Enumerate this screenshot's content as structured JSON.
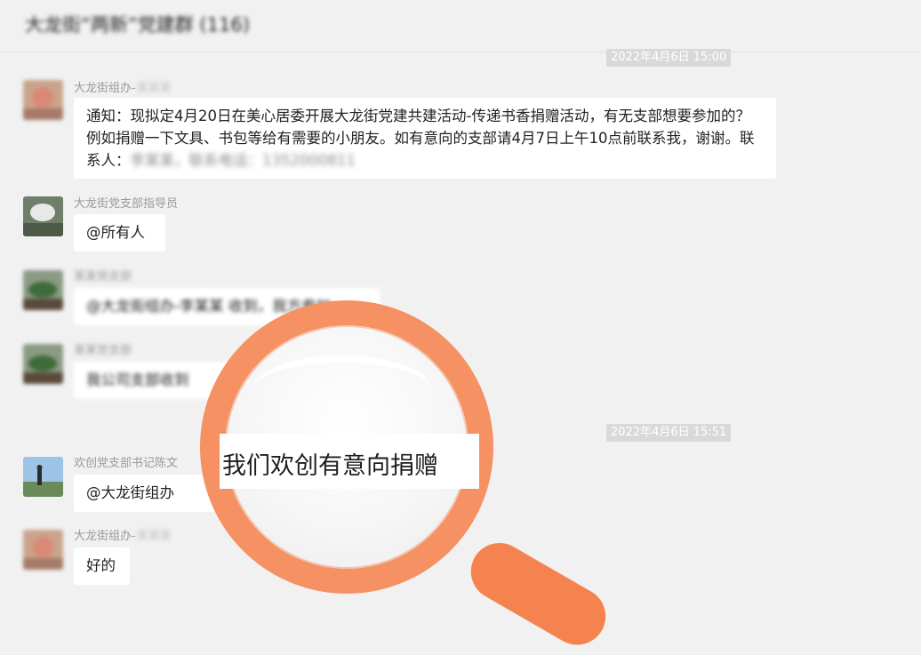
{
  "header": {
    "title": "大龙街“两新”党建群 (116)"
  },
  "timestamps": [
    "2022年4月6日 15:00",
    "2022年4月6日 15:51"
  ],
  "messages": [
    {
      "sender": "大龙街组办-",
      "sender_redacted": "某某某",
      "text": "通知：现拟定4月20日在美心居委开展大龙街党建共建活动-传递书香捐赠活动，有无支部想要参加的？例如捐赠一下文具、书包等给有需要的小朋友。如有意向的支部请4月7日上午10点前联系我，谢谢。联系人：",
      "text_redacted": "李某某，联系电话：1352000811"
    },
    {
      "sender": "大龙街党支部指导员",
      "text": "@所有人"
    },
    {
      "sender": "某某党支部",
      "text": "@大龙街组办-李某某 收到，我方参加",
      "blurred": true
    },
    {
      "sender": "某某党支部",
      "text": "我公司支部收到",
      "blurred": true
    },
    {
      "sender": "欢创党支部书记陈文",
      "text": "@大龙街组办"
    },
    {
      "sender": "大龙街组办-",
      "sender_redacted": "某某某",
      "text": "好的"
    }
  ],
  "magnifier": {
    "text": "我们欢创有意向捐赠"
  },
  "colors": {
    "accent": "#f59163",
    "bubble": "#ffffff",
    "background": "#f1f1f1"
  }
}
